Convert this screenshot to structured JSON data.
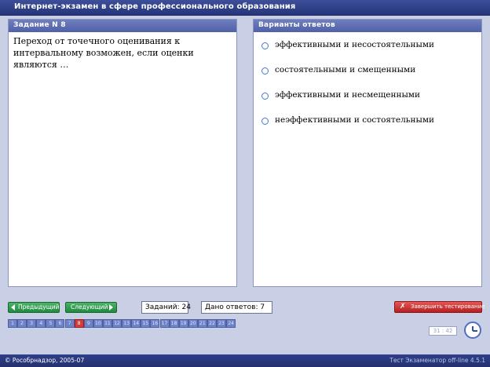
{
  "window": {
    "title": "Интернет-экзамен в сфере профессионального образования"
  },
  "question": {
    "header": "Задание N 8",
    "text": "Переход от точечного оценивания к интервальному возможен, если оценки являются …"
  },
  "answers": {
    "header": "Варианты ответов",
    "options": [
      "эффективными и несостоятельными",
      "состоятельными и смещенными",
      "эффективными и несмещенными",
      "неэффективными и состоятельными"
    ]
  },
  "navigation": {
    "prev_label": "Предыдущий",
    "next_label": "Следующий",
    "finish_label": "Завершить тестирование",
    "tasks_label": "Заданий: 24",
    "answered_label": "Дано ответов: 7",
    "current_question": 8,
    "question_numbers": [
      "1",
      "2",
      "3",
      "4",
      "5",
      "6",
      "7",
      "8",
      "9",
      "10",
      "11",
      "12",
      "13",
      "14",
      "15",
      "16",
      "17",
      "18",
      "19",
      "20",
      "21",
      "22",
      "23",
      "24"
    ]
  },
  "timer": {
    "value": "31 : 42"
  },
  "footer": {
    "left": "© Рособрнадзор, 2005-07",
    "right": "Тест Экзаменатор off-line 4.5.1"
  },
  "icons": {
    "prev": "arrow-left-icon",
    "next": "arrow-right-icon",
    "finish": "running-man-icon",
    "clock": "clock-icon",
    "radio": "radio-icon"
  },
  "colors": {
    "title_bar": "#26357a",
    "panel_header": "#5566ae",
    "nav_button": "#2a9a4a",
    "finish_button": "#c62a2a",
    "current_question": "#d43b3b",
    "question_number": "#6f83c9",
    "background": "#c9d0e6"
  }
}
